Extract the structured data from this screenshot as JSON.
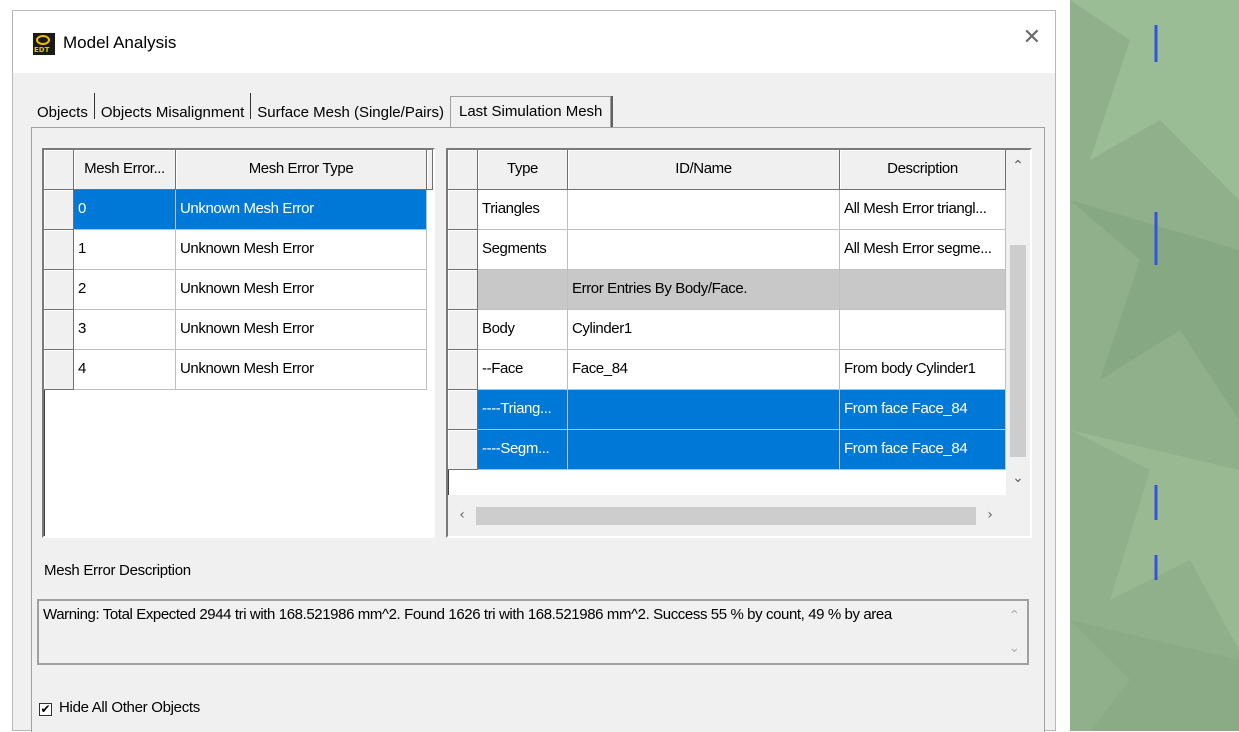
{
  "window": {
    "title": "Model Analysis",
    "app_icon_text": "EDT",
    "close_glyph": "✕"
  },
  "tabs": [
    {
      "label": "Objects",
      "active": false
    },
    {
      "label": "Objects Misalignment",
      "active": false
    },
    {
      "label": "Surface Mesh (Single/Pairs)",
      "active": false
    },
    {
      "label": "Last Simulation Mesh",
      "active": true
    }
  ],
  "errors_table": {
    "columns": [
      "Mesh Error...",
      "Mesh Error Type"
    ],
    "rows": [
      {
        "id": "0",
        "type": "Unknown Mesh Error",
        "selected": true
      },
      {
        "id": "1",
        "type": "Unknown Mesh Error",
        "selected": false
      },
      {
        "id": "2",
        "type": "Unknown Mesh Error",
        "selected": false
      },
      {
        "id": "3",
        "type": "Unknown Mesh Error",
        "selected": false
      },
      {
        "id": "4",
        "type": "Unknown Mesh Error",
        "selected": false
      }
    ]
  },
  "entries_table": {
    "columns": [
      "Type",
      "ID/Name",
      "Description"
    ],
    "rows": [
      {
        "type": "Triangles",
        "id": "",
        "desc": "All Mesh Error triangl...",
        "style": ""
      },
      {
        "type": "Segments",
        "id": "",
        "desc": "All Mesh Error segme...",
        "style": ""
      },
      {
        "type": "",
        "id": "Error Entries By Body/Face.",
        "desc": "",
        "style": "gray"
      },
      {
        "type": "Body",
        "id": "Cylinder1",
        "desc": "",
        "style": ""
      },
      {
        "type": "--Face",
        "id": "Face_84",
        "desc": "From body Cylinder1",
        "style": ""
      },
      {
        "type": "----Triang...",
        "id": "",
        "desc": "From face Face_84",
        "style": "sel"
      },
      {
        "type": "----Segm...",
        "id": "",
        "desc": "From face Face_84",
        "style": "sel"
      }
    ]
  },
  "description": {
    "label": "Mesh Error Description",
    "text": "Warning: Total Expected 2944 tri with 168.521986 mm^2. Found 1626 tri with 168.521986 mm^2. Success 55 % by count, 49 % by area"
  },
  "options": {
    "hide_label": "Hide All Other Objects",
    "hide_checked": true,
    "check_glyph": "✔"
  },
  "colors": {
    "selection": "#0078d7",
    "viewport": "#8fb08a"
  }
}
